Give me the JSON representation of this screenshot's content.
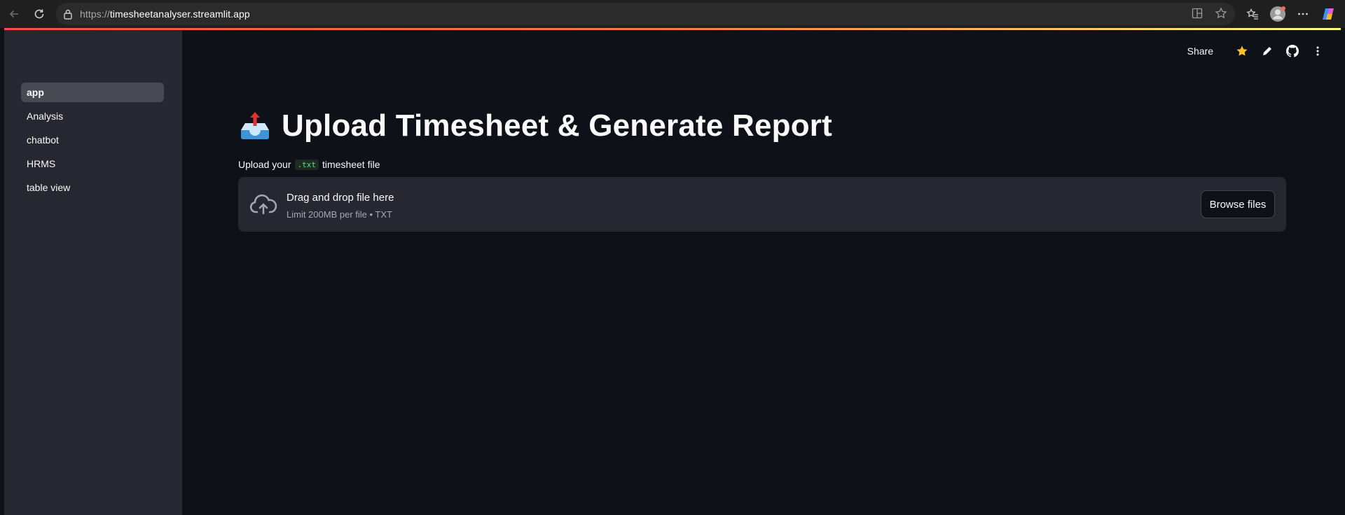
{
  "browser": {
    "url_scheme": "https://",
    "url_host": "timesheetanalyser.streamlit.app"
  },
  "sidebar": {
    "items": [
      {
        "label": "app",
        "active": true
      },
      {
        "label": "Analysis",
        "active": false
      },
      {
        "label": "chatbot",
        "active": false
      },
      {
        "label": "HRMS",
        "active": false
      },
      {
        "label": "table view",
        "active": false
      }
    ]
  },
  "toolbar": {
    "share_label": "Share",
    "icons": [
      "star-icon",
      "edit-pencil-icon",
      "github-icon",
      "more-vertical-icon"
    ]
  },
  "main": {
    "title": "Upload Timesheet & Generate Report",
    "title_emoji": "outbox-tray",
    "upload_label_prefix": "Upload your",
    "upload_label_code": ".txt",
    "upload_label_suffix": "timesheet file",
    "dropzone": {
      "title": "Drag and drop file here",
      "subtitle": "Limit 200MB per file • TXT",
      "browse_label": "Browse files"
    }
  },
  "colors": {
    "background": "#0e1117",
    "sidebar": "#262730",
    "accent_start": "#ff4b4b",
    "accent_end": "#fffd80",
    "star": "#f7c320"
  }
}
